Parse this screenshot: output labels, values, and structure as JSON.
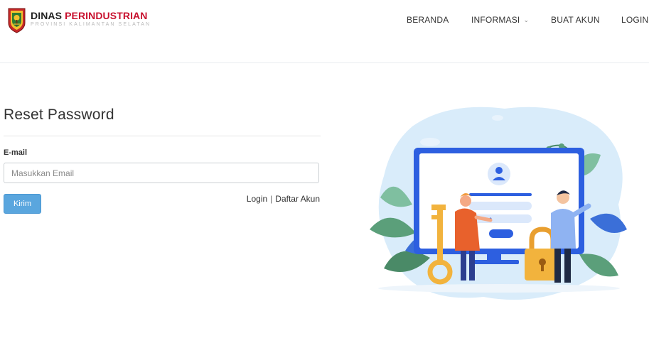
{
  "brand": {
    "title_part1": "DINAS",
    "title_part2": "PERINDUSTRIAN",
    "subtitle": "PROVINSI KALIMANTAN SELATAN"
  },
  "nav": {
    "items": [
      {
        "label": "BERANDA"
      },
      {
        "label": "INFORMASI",
        "has_dropdown": true
      },
      {
        "label": "BUAT AKUN"
      },
      {
        "label": "LOGIN"
      }
    ],
    "dropdown_icon": "chevron-down-icon"
  },
  "form": {
    "title": "Reset Password",
    "email_label": "E-mail",
    "email_placeholder": "Masukkan Email",
    "email_value": "",
    "submit_label": "Kirim",
    "login_link": "Login",
    "separator": "|",
    "register_link": "Daftar Akun"
  },
  "colors": {
    "brand_red": "#c8102e",
    "button_blue": "#5aa6de",
    "illustration_blue": "#2d5fe0",
    "illustration_light": "#d9ecfa"
  },
  "icons": {
    "emblem": "province-emblem-logo",
    "illustration": "login-security-illustration"
  }
}
